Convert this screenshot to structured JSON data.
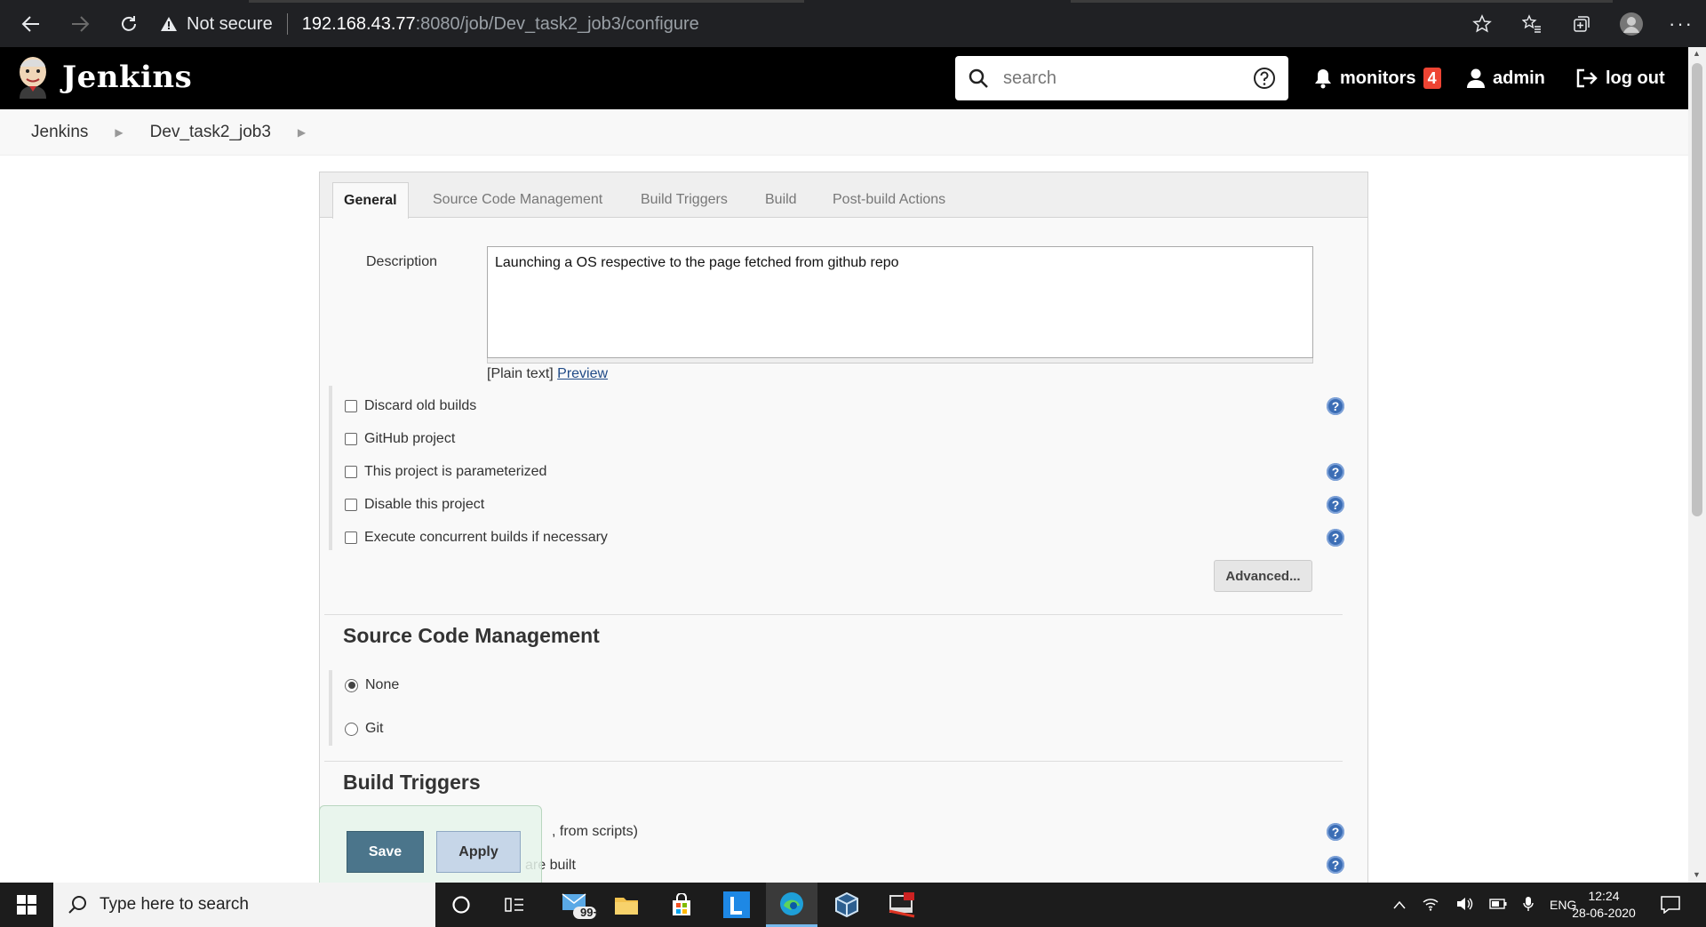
{
  "browser": {
    "security_label": "Not secure",
    "url_host": "192.168.43.77",
    "url_path": ":8080/job/Dev_task2_job3/configure"
  },
  "header": {
    "brand": "Jenkins",
    "search_placeholder": "search",
    "monitors_label": "monitors",
    "monitors_count": "4",
    "user_label": "admin",
    "logout_label": "log out"
  },
  "breadcrumb": {
    "items": [
      "Jenkins",
      "Dev_task2_job3"
    ]
  },
  "tabs": [
    "General",
    "Source Code Management",
    "Build Triggers",
    "Build",
    "Post-build Actions"
  ],
  "general": {
    "description_label": "Description",
    "description_value": "Launching a OS respective to the page fetched from github repo",
    "plain_text_label": "[Plain text]",
    "preview_label": "Preview",
    "options": [
      "Discard old builds",
      "GitHub project",
      "This project is parameterized",
      "Disable this project",
      "Execute concurrent builds if necessary"
    ],
    "advanced_label": "Advanced..."
  },
  "scm": {
    "title": "Source Code Management",
    "options": [
      "None",
      "Git"
    ],
    "selected": "None"
  },
  "build_triggers": {
    "title": "Build Triggers",
    "partial_lines": [
      ", from scripts)",
      "are built"
    ]
  },
  "actions": {
    "save_label": "Save",
    "apply_label": "Apply"
  },
  "taskbar": {
    "search_placeholder": "Type here to search",
    "mail_badge": "99+",
    "language": "ENG",
    "time": "12:24",
    "date": "28-06-2020"
  },
  "colors": {
    "jenkins_header": "#000000",
    "save_button": "#4b758b",
    "apply_button": "#c6d6e8",
    "help_icon": "#3b6db5",
    "badge": "#ee4433"
  }
}
